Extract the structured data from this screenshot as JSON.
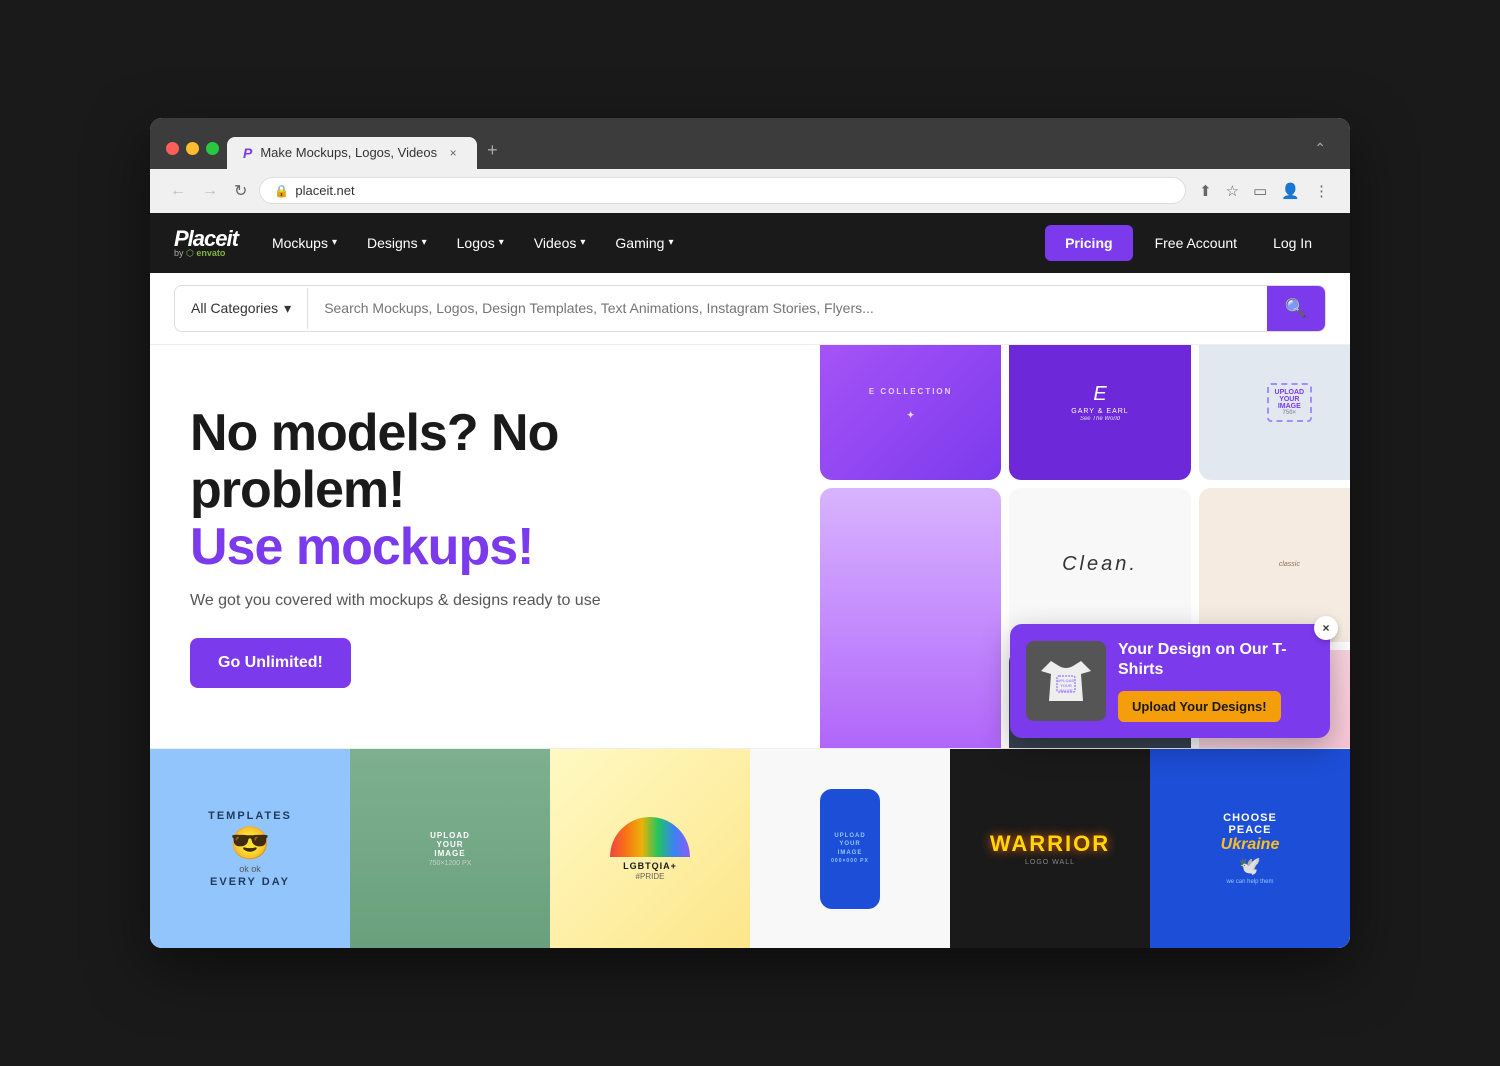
{
  "browser": {
    "tab_title": "Make Mockups, Logos, Videos",
    "tab_close": "×",
    "tab_new": "+",
    "address": "placeit.net",
    "back_arrow": "←",
    "forward_arrow": "→",
    "refresh": "↻",
    "chevron_down": "▾"
  },
  "nav": {
    "logo_text": "Placeit",
    "logo_by": "by",
    "logo_envato": "envato",
    "menu_items": [
      {
        "label": "Mockups",
        "id": "mockups"
      },
      {
        "label": "Designs",
        "id": "designs"
      },
      {
        "label": "Logos",
        "id": "logos"
      },
      {
        "label": "Videos",
        "id": "videos"
      },
      {
        "label": "Gaming",
        "id": "gaming"
      }
    ],
    "pricing_label": "Pricing",
    "free_account_label": "Free Account",
    "login_label": "Log In"
  },
  "search": {
    "category_label": "All Categories",
    "placeholder": "Search Mockups, Logos, Design Templates, Text Animations, Instagram Stories, Flyers...",
    "search_icon": "🔍"
  },
  "hero": {
    "title_dark": "No models? No problem!",
    "title_purple": "Use mockups!",
    "subtitle": "We got you covered with mockups & designs ready to use",
    "cta_label": "Go Unlimited!"
  },
  "popup": {
    "title": "Your Design on Our T-Shirts",
    "cta_label": "Upload Your Designs!",
    "close": "×"
  },
  "thumbnails": [
    {
      "label": "TEMPLATES\nEVERY DAY",
      "style": "blue"
    },
    {
      "label": "UPLOAD YOUR IMAGE",
      "style": "green"
    },
    {
      "label": "LGBTQIA+ #PRIDE",
      "style": "yellow"
    },
    {
      "label": "UPLOAD YOUR IMAGE",
      "style": "blue2"
    },
    {
      "label": "WARRIOR",
      "style": "dark"
    },
    {
      "label": "CHOOSE PEACE Ukraine",
      "style": "ukraine"
    }
  ]
}
